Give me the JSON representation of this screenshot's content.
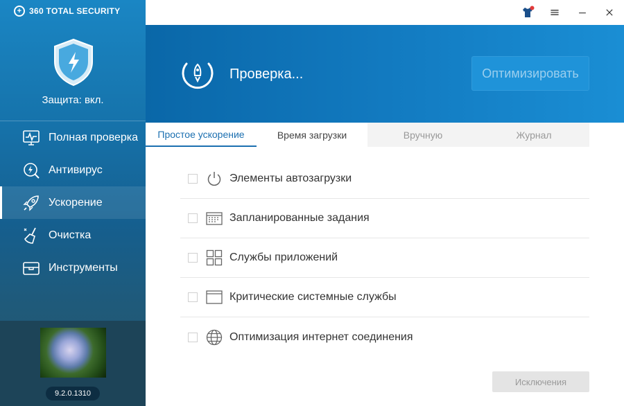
{
  "app": {
    "brand": "360 TOTAL SECURITY",
    "version": "9.2.0.1310"
  },
  "protection": {
    "status": "Защита: вкл."
  },
  "sidebar": {
    "items": [
      {
        "label": "Полная проверка",
        "icon": "monitor-pulse-icon"
      },
      {
        "label": "Антивирус",
        "icon": "magnifier-bolt-icon"
      },
      {
        "label": "Ускорение",
        "icon": "rocket-icon",
        "active": true
      },
      {
        "label": "Очистка",
        "icon": "broom-icon"
      },
      {
        "label": "Инструменты",
        "icon": "toolbox-icon"
      }
    ]
  },
  "header": {
    "status": "Проверка...",
    "optimize_button": "Оптимизировать"
  },
  "tabs": [
    {
      "label": "Простое ускорение",
      "active": true
    },
    {
      "label": "Время загрузки"
    },
    {
      "label": "Вручную"
    },
    {
      "label": "Журнал"
    }
  ],
  "items": [
    {
      "label": "Элементы автозагрузки",
      "icon": "power-icon"
    },
    {
      "label": "Запланированные задания",
      "icon": "calendar-icon"
    },
    {
      "label": "Службы приложений",
      "icon": "grid-icon"
    },
    {
      "label": "Критические системные службы",
      "icon": "window-icon"
    },
    {
      "label": "Оптимизация интернет соединения",
      "icon": "globe-icon"
    }
  ],
  "footer": {
    "exclusions_button": "Исключения"
  },
  "colors": {
    "accent": "#1b6fb0",
    "header": "#127ac0",
    "notification_dot": "#e23a3a"
  }
}
